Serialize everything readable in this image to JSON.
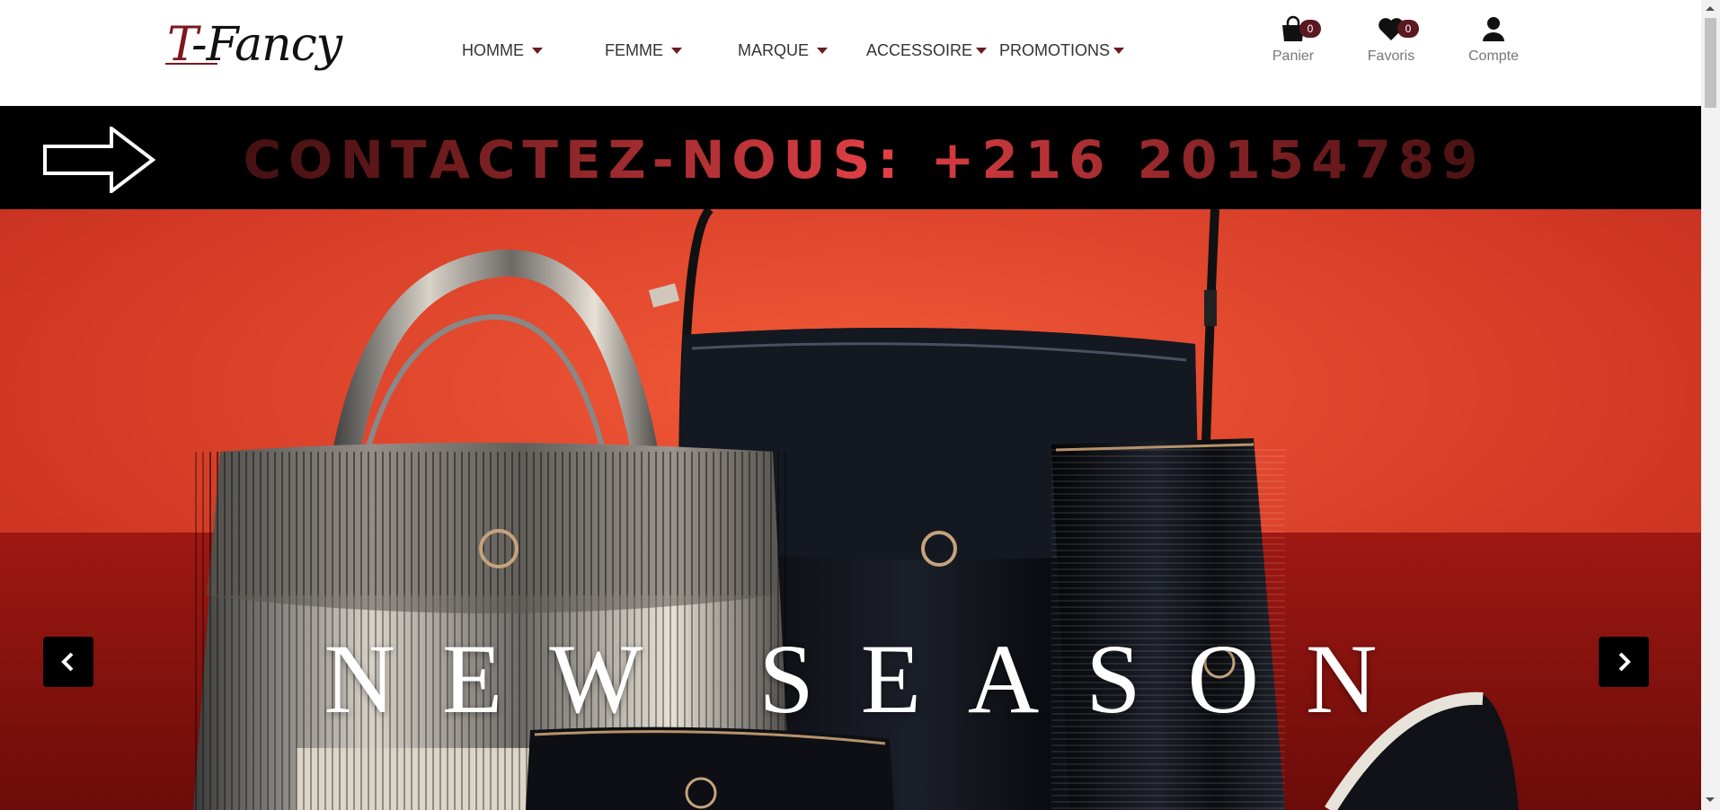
{
  "brand": {
    "logo_text_t": "T",
    "logo_text_rest": "-Fancy"
  },
  "nav": {
    "items": [
      {
        "label": "HOMME"
      },
      {
        "label": "FEMME"
      },
      {
        "label": "MARQUE"
      },
      {
        "label": "ACCESSOIRE"
      },
      {
        "label": "PROMOTIONS"
      }
    ]
  },
  "header_actions": {
    "cart": {
      "label": "Panier",
      "count": "0",
      "icon": "shopping-bag-icon"
    },
    "favorites": {
      "label": "Favoris",
      "count": "0",
      "icon": "heart-icon"
    },
    "account": {
      "label": "Compte",
      "icon": "user-icon"
    }
  },
  "banner": {
    "text": "CONTACTEZ-NOUS: +216 20154789",
    "icon": "arrow-right-outline-icon"
  },
  "hero": {
    "title": "NEW SEASON",
    "prev_icon": "chevron-left-icon",
    "next_icon": "chevron-right-icon"
  },
  "colors": {
    "brand": "#7d1620",
    "badge": "#5a1822",
    "banner_bg": "#000000",
    "banner_text": "#e24045",
    "hero_bg": "#c63020"
  }
}
